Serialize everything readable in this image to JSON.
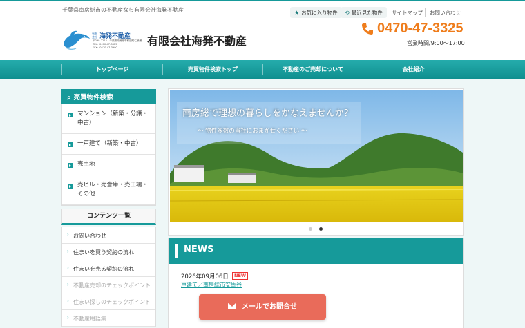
{
  "header": {
    "tagline": "千葉県南房総市の不動産なら有限会社海発不動産",
    "toolbar": {
      "favorites_label": "お気に入り物件",
      "history_label": "最近見た物件",
      "sitemap_label": "サイトマップ",
      "contact_label": "お問い合わせ"
    },
    "logo": {
      "small_label": "有限会社",
      "brand": "海発不動産",
      "address_line1": "〒299-2212　千葉県南房総市和田町仁我浦",
      "address_line2": "TEL：0470-47-3325",
      "address_line3": "FAX：0470-47-3900"
    },
    "company_name": "有限会社海発不動産",
    "phone": "0470-47-3325",
    "hours": "営業時間/9:00～17:00"
  },
  "nav": {
    "items": [
      {
        "label": "トップページ"
      },
      {
        "label": "売買物件検索トップ"
      },
      {
        "label": "不動産のご売却について"
      },
      {
        "label": "会社紹介"
      }
    ]
  },
  "sidebar": {
    "search_title": "売買物件検索",
    "search_items": [
      {
        "label": "マンション（新築・分譲・中古）"
      },
      {
        "label": "一戸建て（新築・中古）"
      },
      {
        "label": "売土地"
      },
      {
        "label": "売ビル・売倉庫・売工場・その他"
      }
    ],
    "contents_title": "コンテンツ一覧",
    "contents_items": [
      {
        "label": "お問い合わせ"
      },
      {
        "label": "住まいを買う契約の流れ"
      },
      {
        "label": "住まいを売る契約の流れ"
      },
      {
        "label": "不動産売却のチェックポイント"
      },
      {
        "label": "住まい探しのチェックポイント"
      },
      {
        "label": "不動産用語集"
      }
    ]
  },
  "slider": {
    "catch_main": "南房総で理想の暮らしをかなえませんか？",
    "catch_sub": "～ 物件多数の当社におまかせください ～",
    "colors": {
      "dot_inactive": "#cccccc",
      "dot_active": "#333333"
    }
  },
  "news": {
    "title": "NEWS",
    "entries": [
      {
        "date": "2026年09月06日",
        "badge": "NEW",
        "link": "戸建て／南房総市安馬谷"
      }
    ]
  },
  "cta": {
    "mail_label": "メールでお問合せ"
  },
  "colors": {
    "accent": "#169a9a",
    "phone": "#ef7d1c",
    "cta": "#e96b5a"
  }
}
